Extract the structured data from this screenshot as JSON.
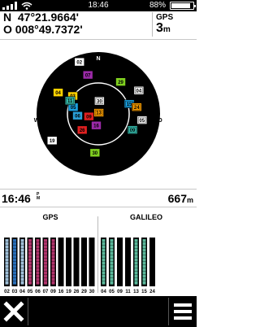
{
  "status": {
    "time": "18:46",
    "battery_text": "88%",
    "battery_level": 0.88,
    "signal_icon": "signal-bars-icon",
    "wifi_icon": "wifi-icon",
    "battery_icon": "battery-icon"
  },
  "position": {
    "lat_line": "N  47°21.9664'",
    "lon_line": "O 008°49.7372'"
  },
  "gps_accuracy": {
    "label": "GPS",
    "value": "3",
    "unit": "m"
  },
  "skyview": {
    "directions": {
      "north": "N",
      "east": "O",
      "south": "S",
      "west": "W"
    },
    "satellites": [
      {
        "id": "02",
        "az": 340,
        "el": 5,
        "color": "#ffffff",
        "kind": "gps"
      },
      {
        "id": "03",
        "az": 305,
        "el": 42,
        "color": "#ffd200",
        "kind": "gps"
      },
      {
        "id": "04",
        "az": 298,
        "el": 20,
        "color": "#ffd200",
        "kind": "gps"
      },
      {
        "id": "05",
        "az": 285,
        "el": 50,
        "color": "#1aa0e0",
        "kind": "gps"
      },
      {
        "id": "06",
        "az": 265,
        "el": 58,
        "color": "#2a9fd6",
        "kind": "gps"
      },
      {
        "id": "07",
        "az": 345,
        "el": 28,
        "color": "#9b2aa8",
        "kind": "gps"
      },
      {
        "id": "09",
        "az": 255,
        "el": 75,
        "color": "#e02020",
        "kind": "gps"
      },
      {
        "id": "16",
        "az": 190,
        "el": 72,
        "color": "#9b2aa8",
        "kind": "gps"
      },
      {
        "id": "19",
        "az": 240,
        "el": 8,
        "color": "#ffffff",
        "kind": "gps"
      },
      {
        "id": "26",
        "az": 225,
        "el": 55,
        "color": "#e02020",
        "kind": "gps"
      },
      {
        "id": "29",
        "az": 35,
        "el": 30,
        "color": "#80d020",
        "kind": "gps"
      },
      {
        "id": "30",
        "az": 185,
        "el": 30,
        "color": "#80d020",
        "kind": "gps"
      },
      {
        "id": "04",
        "az": 60,
        "el": 18,
        "color": "#ffffff",
        "kind": "galileo"
      },
      {
        "id": "05",
        "az": 98,
        "el": 22,
        "color": "#ffffff",
        "kind": "galileo"
      },
      {
        "id": "09",
        "az": 115,
        "el": 32,
        "color": "#36c0b0",
        "kind": "galileo"
      },
      {
        "id": "11",
        "az": 295,
        "el": 42,
        "color": "#36c0b0",
        "kind": "galileo"
      },
      {
        "id": "13",
        "az": 22,
        "el": 88,
        "color": "#ffa000",
        "kind": "galileo"
      },
      {
        "id": "15",
        "az": 72,
        "el": 40,
        "color": "#1aa0e0",
        "kind": "galileo"
      },
      {
        "id": "24",
        "az": 80,
        "el": 30,
        "color": "#ffa000",
        "kind": "galileo"
      },
      {
        "id": "30",
        "az": 5,
        "el": 70,
        "color": "#ffffff",
        "kind": "galileo"
      }
    ]
  },
  "readouts": {
    "time": "16:46",
    "time_suffix": "P\nM",
    "elevation": "667",
    "elevation_unit": "m"
  },
  "constellations": {
    "gps_label": "GPS",
    "galileo_label": "GALILEO",
    "gps_bars": [
      {
        "id": "02",
        "strength": 0.0,
        "color": "#9fbfd8"
      },
      {
        "id": "03",
        "strength": 0.95,
        "color": "#2a6fb8"
      },
      {
        "id": "04",
        "strength": 0.0,
        "color": "#9fbfd8"
      },
      {
        "id": "05",
        "strength": 0.92,
        "color": "#b0336a"
      },
      {
        "id": "06",
        "strength": 0.92,
        "color": "#b0336a"
      },
      {
        "id": "07",
        "strength": 0.92,
        "color": "#b0336a"
      },
      {
        "id": "09",
        "strength": 0.92,
        "color": "#b0336a"
      },
      {
        "id": "16",
        "strength": 0.0,
        "color": "#000000"
      },
      {
        "id": "19",
        "strength": 0.0,
        "color": "#000000"
      },
      {
        "id": "26",
        "strength": 0.0,
        "color": "#000000"
      },
      {
        "id": "29",
        "strength": 0.0,
        "color": "#000000"
      },
      {
        "id": "30",
        "strength": 0.0,
        "color": "#000000"
      }
    ],
    "galileo_bars": [
      {
        "id": "04",
        "strength": 0.0,
        "color": "#5ab89a"
      },
      {
        "id": "05",
        "strength": 0.0,
        "color": "#5ab89a"
      },
      {
        "id": "09",
        "strength": 0.0,
        "color": "#000000"
      },
      {
        "id": "11",
        "strength": 0.0,
        "color": "#000000"
      },
      {
        "id": "13",
        "strength": 0.0,
        "color": "#5ab89a"
      },
      {
        "id": "15",
        "strength": 0.0,
        "color": "#5ab89a"
      },
      {
        "id": "24",
        "strength": 0.0,
        "color": "#000000"
      }
    ]
  },
  "toolbar": {
    "close_icon": "close-icon",
    "menu_icon": "menu-icon"
  }
}
